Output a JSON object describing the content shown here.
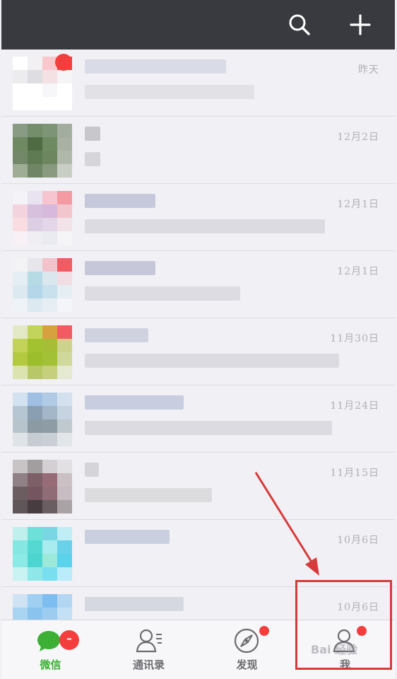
{
  "header": {
    "search_icon": "search-icon",
    "add_icon": "plus-icon"
  },
  "chats": [
    {
      "time": "昨天",
      "unread_dot": true,
      "avatar": [
        "#ffffff",
        "#f2f0f3",
        "#f8c8cc",
        "#f43e3e",
        "#ececee",
        "#dedde2",
        "#f3e1e4",
        "#f5f4f6",
        "#ffffff",
        "#ffffff",
        "#f7f6f8",
        "#ffffff",
        "#ffffff",
        "#ffffff",
        "#ffffff",
        "#ffffff"
      ],
      "name_color": "#d9dbe6",
      "name_w": 200,
      "msg_color": "#e2e1e6",
      "msg_w": 240
    },
    {
      "time": "12月2日",
      "unread_dot": false,
      "avatar": [
        "#8a9b84",
        "#748d6b",
        "#7e9476",
        "#a3ad9f",
        "#6f8a62",
        "#4f6b44",
        "#6d8a60",
        "#a8b1a3",
        "#728868",
        "#5f7b53",
        "#6d865f",
        "#b0b8ab",
        "#9fad96",
        "#6f8565",
        "#8a9a80",
        "#c9cec5"
      ],
      "name_color": "#c8c8cc",
      "name_w": 22,
      "msg_color": "#d5d5da",
      "msg_w": 22
    },
    {
      "time": "12月1日",
      "unread_dot": false,
      "avatar": [
        "#f4f3f8",
        "#e8e3ef",
        "#f6c5cf",
        "#f49aa2",
        "#f2d3de",
        "#d6c0dd",
        "#d7b9dc",
        "#f3c5cd",
        "#f8dce2",
        "#dccfe4",
        "#e2d6e8",
        "#f2e3e8",
        "#f7f1f5",
        "#eeeef3",
        "#eaeaf1",
        "#f5f4f7"
      ],
      "name_color": "#c6c9dc",
      "name_w": 100,
      "msg_color": "#dcdbe1",
      "msg_w": 340
    },
    {
      "time": "12月1日",
      "unread_dot": false,
      "avatar": [
        "#f3f3f6",
        "#e7e6ec",
        "#f3c3cb",
        "#f25b62",
        "#e4eef4",
        "#b6dbe4",
        "#dbe7ee",
        "#f1dde3",
        "#dce9f1",
        "#b4d6e8",
        "#c9e0ed",
        "#e4eef3",
        "#eef3f7",
        "#dce9f1",
        "#e6eef4",
        "#f4f5f8"
      ],
      "name_color": "#c6c8da",
      "name_w": 100,
      "msg_color": "#dcdce2",
      "msg_w": 220
    },
    {
      "time": "11月30日",
      "unread_dot": false,
      "avatar": [
        "#e3e9c7",
        "#c3d45c",
        "#d7a13f",
        "#f25b62",
        "#c3d259",
        "#a2c230",
        "#a6bd36",
        "#cdd38c",
        "#b3c93f",
        "#9cbe2d",
        "#a3c136",
        "#d0d89b",
        "#dde3b0",
        "#b8c868",
        "#c6d07c",
        "#e6e9d2"
      ],
      "name_color": "#d0d3df",
      "name_w": 90,
      "msg_color": "#dcdbe2",
      "msg_w": 360
    },
    {
      "time": "11月24日",
      "unread_dot": false,
      "avatar": [
        "#d3e2f0",
        "#9fc0e2",
        "#b1cbe6",
        "#d3e1ef",
        "#b6c6d3",
        "#8aa0b2",
        "#a4b7c8",
        "#c5d4e0",
        "#b8c4cc",
        "#8c9aa4",
        "#8e9ca6",
        "#c0c9cf",
        "#dfe3e7",
        "#c6ccd1",
        "#c9cfd4",
        "#e3e6e8"
      ],
      "name_color": "#c8cde0",
      "name_w": 140,
      "msg_color": "#dcdbe1",
      "msg_w": 350
    },
    {
      "time": "11月15日",
      "unread_dot": false,
      "avatar": [
        "#c8c4c6",
        "#a29ea0",
        "#d4cfd2",
        "#e3e0e3",
        "#8f8185",
        "#7d5f68",
        "#986c77",
        "#cbc1c5",
        "#6c5d60",
        "#755660",
        "#8f6c76",
        "#c6bcc1",
        "#5f5659",
        "#473c40",
        "#6a5e63",
        "#aaa3a6"
      ],
      "name_color": "#d4d4d9",
      "name_w": 20,
      "msg_color": "#dcdcdf",
      "msg_w": 180
    },
    {
      "time": "10月6日",
      "unread_dot": false,
      "avatar": [
        "#bff0ed",
        "#6ee0da",
        "#79d7e3",
        "#c1eef5",
        "#86e6e2",
        "#54d8d1",
        "#a9ecef",
        "#69d1ea",
        "#8ce9e6",
        "#4dd6cf",
        "#9bead9",
        "#5ad3ec",
        "#c8f3f2",
        "#8fe7e8",
        "#79dff0",
        "#b9ecf8"
      ],
      "name_color": "#c9cfdf",
      "name_w": 120,
      "msg_color": "#e4e3e8",
      "msg_w": 0
    },
    {
      "time": "10月6日",
      "unread_dot": false,
      "avatar": [
        "#cfe3f5",
        "#9fd0f2",
        "#7ebdf0",
        "#b3d6f3",
        "#a9d5f2",
        "#8ac4ee",
        "#9cccf0",
        "#c3e0f5",
        "#e4f0f9",
        "#d2e7f6",
        "#d8e9f7",
        "#eaf3fa",
        "#f4f8fb",
        "#eef4f9",
        "#f1f6fa",
        "#f6f8fb"
      ],
      "name_color": "#d6d8e1",
      "name_w": 140,
      "msg_color": "#e4e3e8",
      "msg_w": 0
    }
  ],
  "tabs": [
    {
      "label": "微信",
      "icon": "chat-bubble-icon",
      "active": true,
      "count": "–"
    },
    {
      "label": "通讯录",
      "icon": "contacts-icon",
      "active": false
    },
    {
      "label": "发现",
      "icon": "compass-icon",
      "active": false,
      "dot": true
    },
    {
      "label": "我",
      "icon": "person-icon",
      "active": false,
      "dot": true
    }
  ],
  "colors": {
    "header_bg": "#393a3f",
    "accent_green": "#3cb034",
    "badge_red": "#f43e3e",
    "annotation_red": "#d73a3a"
  },
  "watermark": "Bai 经验"
}
